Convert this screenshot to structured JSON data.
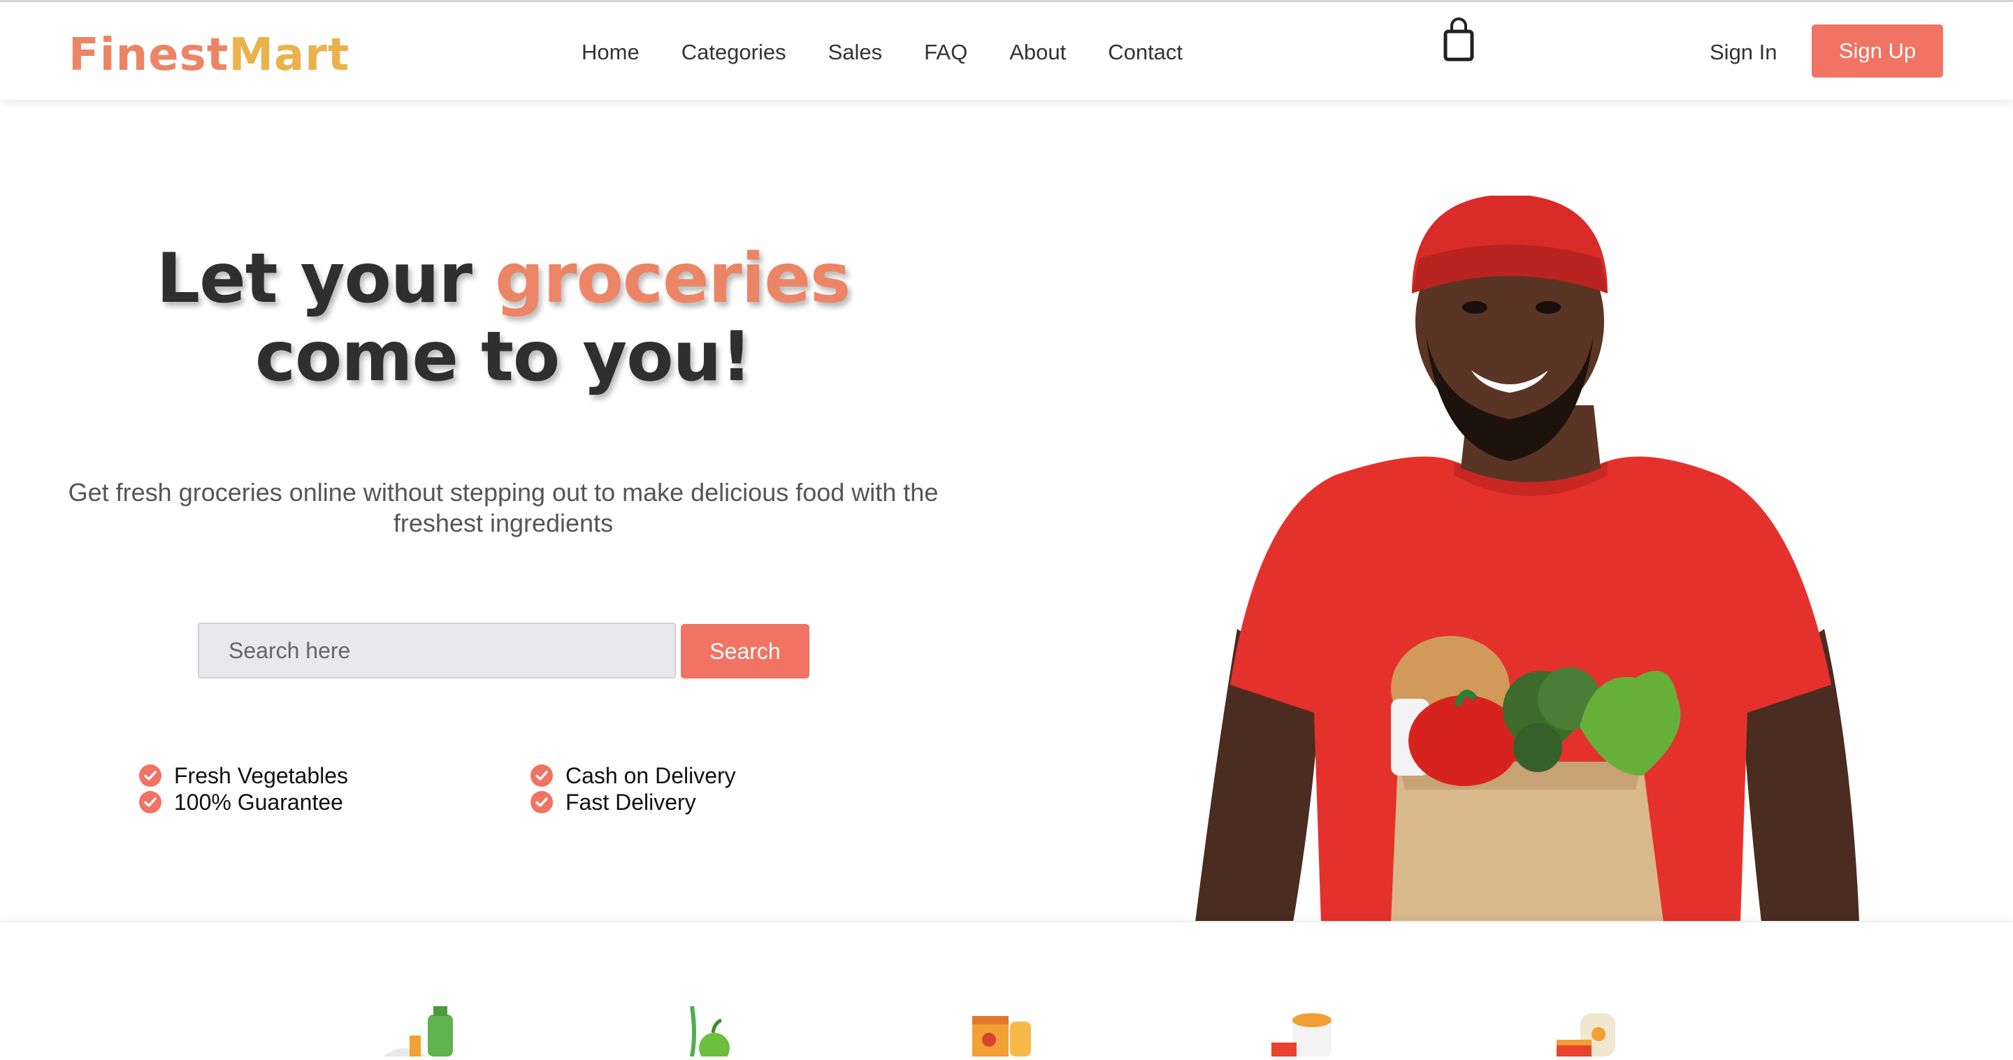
{
  "brand": {
    "part1": "Finest",
    "part2": "Mart"
  },
  "nav": {
    "items": [
      "Home",
      "Categories",
      "Sales",
      "FAQ",
      "About",
      "Contact"
    ]
  },
  "auth": {
    "sign_in": "Sign In",
    "sign_up": "Sign Up"
  },
  "icons": {
    "cart": "shopping-bag-icon",
    "feature": "check-circle-icon"
  },
  "colors": {
    "accent": "#f07363",
    "brand_orange": "#ec8565",
    "brand_yellow": "#eab24b",
    "heading": "#2f2f2f"
  },
  "hero": {
    "title_before": "Let your ",
    "title_highlight": "groceries",
    "title_after": " come to you!",
    "subtitle": "Get fresh groceries online without stepping out to make delicious food with the freshest ingredients",
    "search": {
      "placeholder": "Search here",
      "value": "",
      "button": "Search"
    },
    "features": [
      "Fresh Vegetables",
      "100% Guarantee",
      "Cash on Delivery",
      "Fast Delivery"
    ]
  }
}
